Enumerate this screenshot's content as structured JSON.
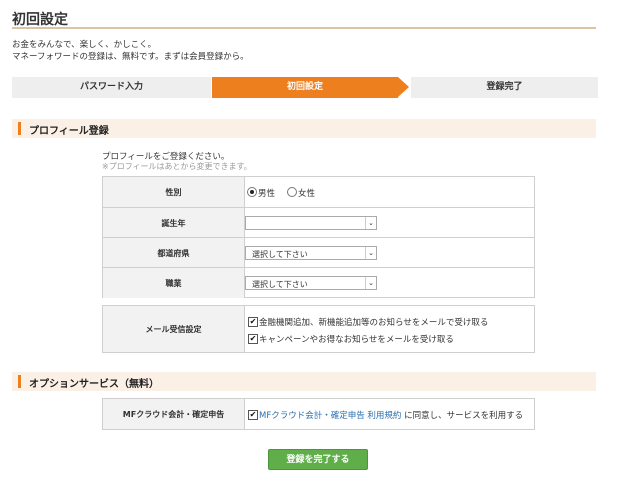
{
  "page": {
    "title": "初回設定",
    "intro_line1": "お金をみんなで、楽しく、かしこく。",
    "intro_line2": "マネーフォワードの登録は、無料です。まずは会員登録から。"
  },
  "steps": [
    {
      "label": "パスワード入力",
      "state": "done"
    },
    {
      "label": "初回設定",
      "state": "active"
    },
    {
      "label": "登録完了",
      "state": "todo"
    }
  ],
  "profile": {
    "section_title": "プロフィール登録",
    "note": "プロフィールをご登録ください。",
    "note_sub": "※プロフィールはあとから変更できます。",
    "gender": {
      "label": "性別",
      "options": [
        "男性",
        "女性"
      ],
      "selected": "男性"
    },
    "birth_year": {
      "label": "誕生年",
      "value": ""
    },
    "prefecture": {
      "label": "都道府県",
      "value": "選択して下さい"
    },
    "occupation": {
      "label": "職業",
      "value": "選択して下さい"
    }
  },
  "mail": {
    "label": "メール受信設定",
    "options": [
      {
        "text": "金融機関追加、新機能追加等のお知らせをメールで受け取る",
        "checked": true
      },
      {
        "text": "キャンペーンやお得なお知らせをメールを受け取る",
        "checked": true
      }
    ]
  },
  "options_section": {
    "section_title": "オプションサービス（無料）",
    "label": "MFクラウド会計・確定申告",
    "link_text": "MFクラウド会計・確定申告 利用規約",
    "agree_text": " に同意し、サービスを利用する",
    "checked": true
  },
  "submit_label": "登録を完了する",
  "colors": {
    "accent": "#ee7f1f",
    "button": "#5fae4a",
    "link": "#2a6fb0"
  },
  "icons": {
    "check": "✔",
    "dropdown": "⌄"
  }
}
